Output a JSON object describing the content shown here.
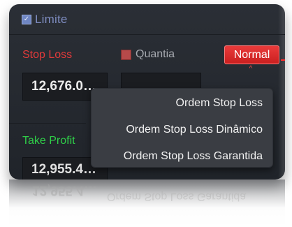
{
  "window": {
    "limite_label": "Limite",
    "stop_loss_label": "Stop Loss",
    "quantia_label": "Quantia",
    "normal_button_label": "Normal",
    "stop_loss_value": "12,676.0…",
    "take_profit_label": "Take Profit",
    "take_profit_value": "12,955.4…",
    "menu_items": [
      "Ordem Stop Loss",
      "Ordem Stop Loss Dinâmico",
      "Ordem Stop Loss Garantida"
    ],
    "reflection_left": "12,955.4…",
    "reflection_right": "Ordem Stop Loss Garantida"
  },
  "colors": {
    "stop_loss_red": "#e23a3a",
    "take_profit_green": "#2fcf48",
    "accent_blue": "#7e8cc0"
  },
  "icons": {
    "limite_checkbox": "checkbox-checked-icon",
    "quantia_checkbox": "checkbox-icon",
    "dropdown_indicator": "chevron-up-icon"
  }
}
